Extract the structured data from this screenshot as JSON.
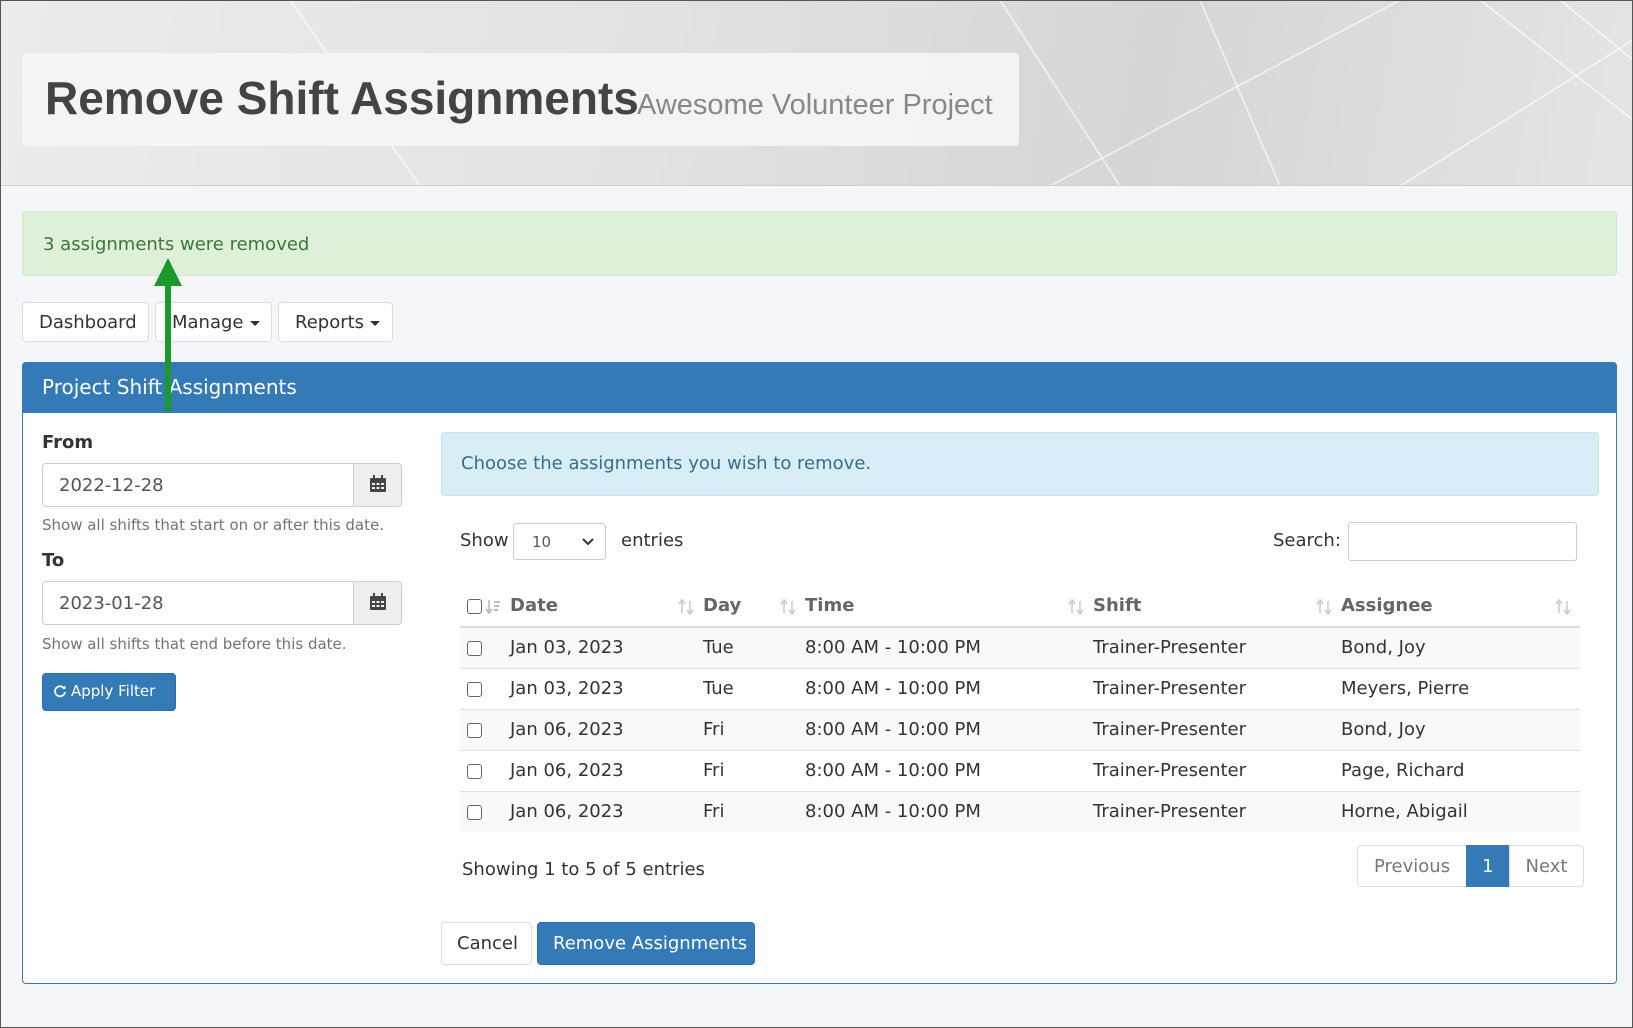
{
  "header": {
    "title": "Remove Shift Assignments",
    "subtitle": "Awesome Volunteer Project"
  },
  "alert": {
    "message": "3 assignments were removed"
  },
  "nav": {
    "dashboard": "Dashboard",
    "manage": "Manage",
    "reports": "Reports"
  },
  "panel": {
    "title": "Project Shift Assignments",
    "filter": {
      "from_label": "From",
      "from_value": "2022-12-28",
      "from_help": "Show all shifts that start on or after this date.",
      "to_label": "To",
      "to_value": "2023-01-28",
      "to_help": "Show all shifts that end before this date.",
      "apply_label": "Apply Filter"
    },
    "info": "Choose the assignments you wish to remove.",
    "length": {
      "show": "Show",
      "value": "10",
      "entries": "entries"
    },
    "search": {
      "label": "Search:",
      "value": ""
    },
    "table": {
      "headers": [
        "Date",
        "Day",
        "Time",
        "Shift",
        "Assignee"
      ],
      "rows": [
        [
          "Jan 03, 2023",
          "Tue",
          "8:00 AM - 10:00 PM",
          "Trainer-Presenter",
          "Bond, Joy"
        ],
        [
          "Jan 03, 2023",
          "Tue",
          "8:00 AM - 10:00 PM",
          "Trainer-Presenter",
          "Meyers, Pierre"
        ],
        [
          "Jan 06, 2023",
          "Fri",
          "8:00 AM - 10:00 PM",
          "Trainer-Presenter",
          "Bond, Joy"
        ],
        [
          "Jan 06, 2023",
          "Fri",
          "8:00 AM - 10:00 PM",
          "Trainer-Presenter",
          "Page, Richard"
        ],
        [
          "Jan 06, 2023",
          "Fri",
          "8:00 AM - 10:00 PM",
          "Trainer-Presenter",
          "Horne, Abigail"
        ]
      ]
    },
    "table_info": "Showing 1 to 5 of 5 entries",
    "pagination": {
      "previous": "Previous",
      "current": "1",
      "next": "Next"
    },
    "cancel_label": "Cancel",
    "remove_label": "Remove Assignments"
  },
  "colors": {
    "primary": "#337ab7",
    "success_bg": "#dff0d8",
    "info_bg": "#d9edf7",
    "annotation_arrow": "#1a9a2a"
  }
}
